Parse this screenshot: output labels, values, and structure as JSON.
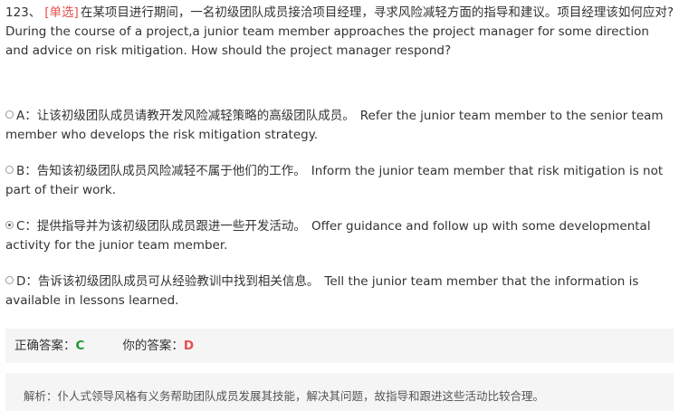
{
  "question": {
    "number": "123、",
    "type_tag": "[单选]",
    "text_zh": "在某项目进行期间，一名初级团队成员接洽项目经理，寻求风险减轻方面的指导和建议。项目经理该如何应对?",
    "text_en": "During the course of a project,a junior team member approaches the project manager for some direction and advice on risk mitigation. How should the project manager respond?"
  },
  "options": [
    {
      "label_zh": "A：让该初级团队成员请教开发风险减轻策略的高级团队成员。",
      "label_en": "Refer the junior team member to the senior team member who develops the risk mitigation strategy.",
      "selected": false
    },
    {
      "label_zh": "B：告知该初级团队成员风险减轻不属于他们的工作。",
      "label_en": "Inform the junior team member that risk mitigation is not part of their work.",
      "selected": false
    },
    {
      "label_zh": "C：提供指导并为该初级团队成员跟进一些开发活动。",
      "label_en": "Offer guidance and follow up with some developmental activity for the junior team member.",
      "selected": true
    },
    {
      "label_zh": "D：告诉该初级团队成员可从经验教训中找到相关信息。",
      "label_en": "Tell the junior team member that the information is available in lessons learned.",
      "selected": false
    }
  ],
  "answer": {
    "correct_label": "正确答案：",
    "correct_value": "C",
    "yours_label": "你的答案：",
    "yours_value": "D"
  },
  "explanation": {
    "text": "解析：仆人式领导风格有义务帮助团队成员发展其技能，解决其问题，故指导和跟进这些活动比较合理。"
  },
  "colors": {
    "type_tag": "#e94e4e",
    "correct": "#1f9a2e",
    "wrong": "#e94e4e",
    "panel_bg": "#f5f5f5"
  }
}
